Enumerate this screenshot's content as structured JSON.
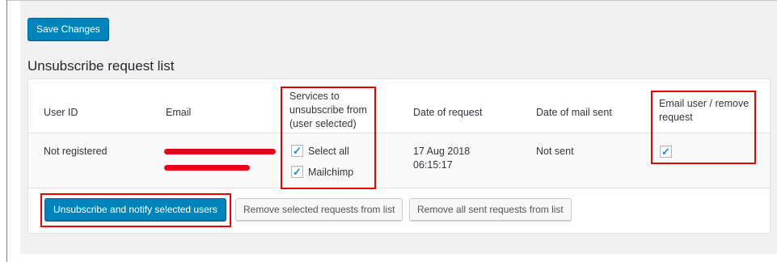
{
  "toolbar": {
    "save_label": "Save Changes"
  },
  "section": {
    "title": "Unsubscribe request list"
  },
  "table": {
    "headers": {
      "user_id": "User ID",
      "email": "Email",
      "services": [
        "Services to",
        "unsubscribe from",
        "(user selected)"
      ],
      "date_request": "Date of request",
      "date_mail": "Date of mail sent",
      "email_remove": [
        "Email user / remove",
        "request"
      ]
    },
    "rows": [
      {
        "user_id": "Not registered",
        "services": [
          {
            "label": "Select all",
            "checked": true
          },
          {
            "label": "Mailchimp",
            "checked": true
          }
        ],
        "date_request": [
          "17 Aug 2018",
          "06:15:17"
        ],
        "date_mail": "Not sent",
        "email_remove_checked": true
      }
    ]
  },
  "actions": {
    "unsubscribe_notify": "Unsubscribe and notify selected users",
    "remove_selected": "Remove selected requests from list",
    "remove_all_sent": "Remove all sent requests from list"
  },
  "colors": {
    "primary": "#0085ba",
    "highlight": "#e60000",
    "redaction": "#e8001a"
  }
}
